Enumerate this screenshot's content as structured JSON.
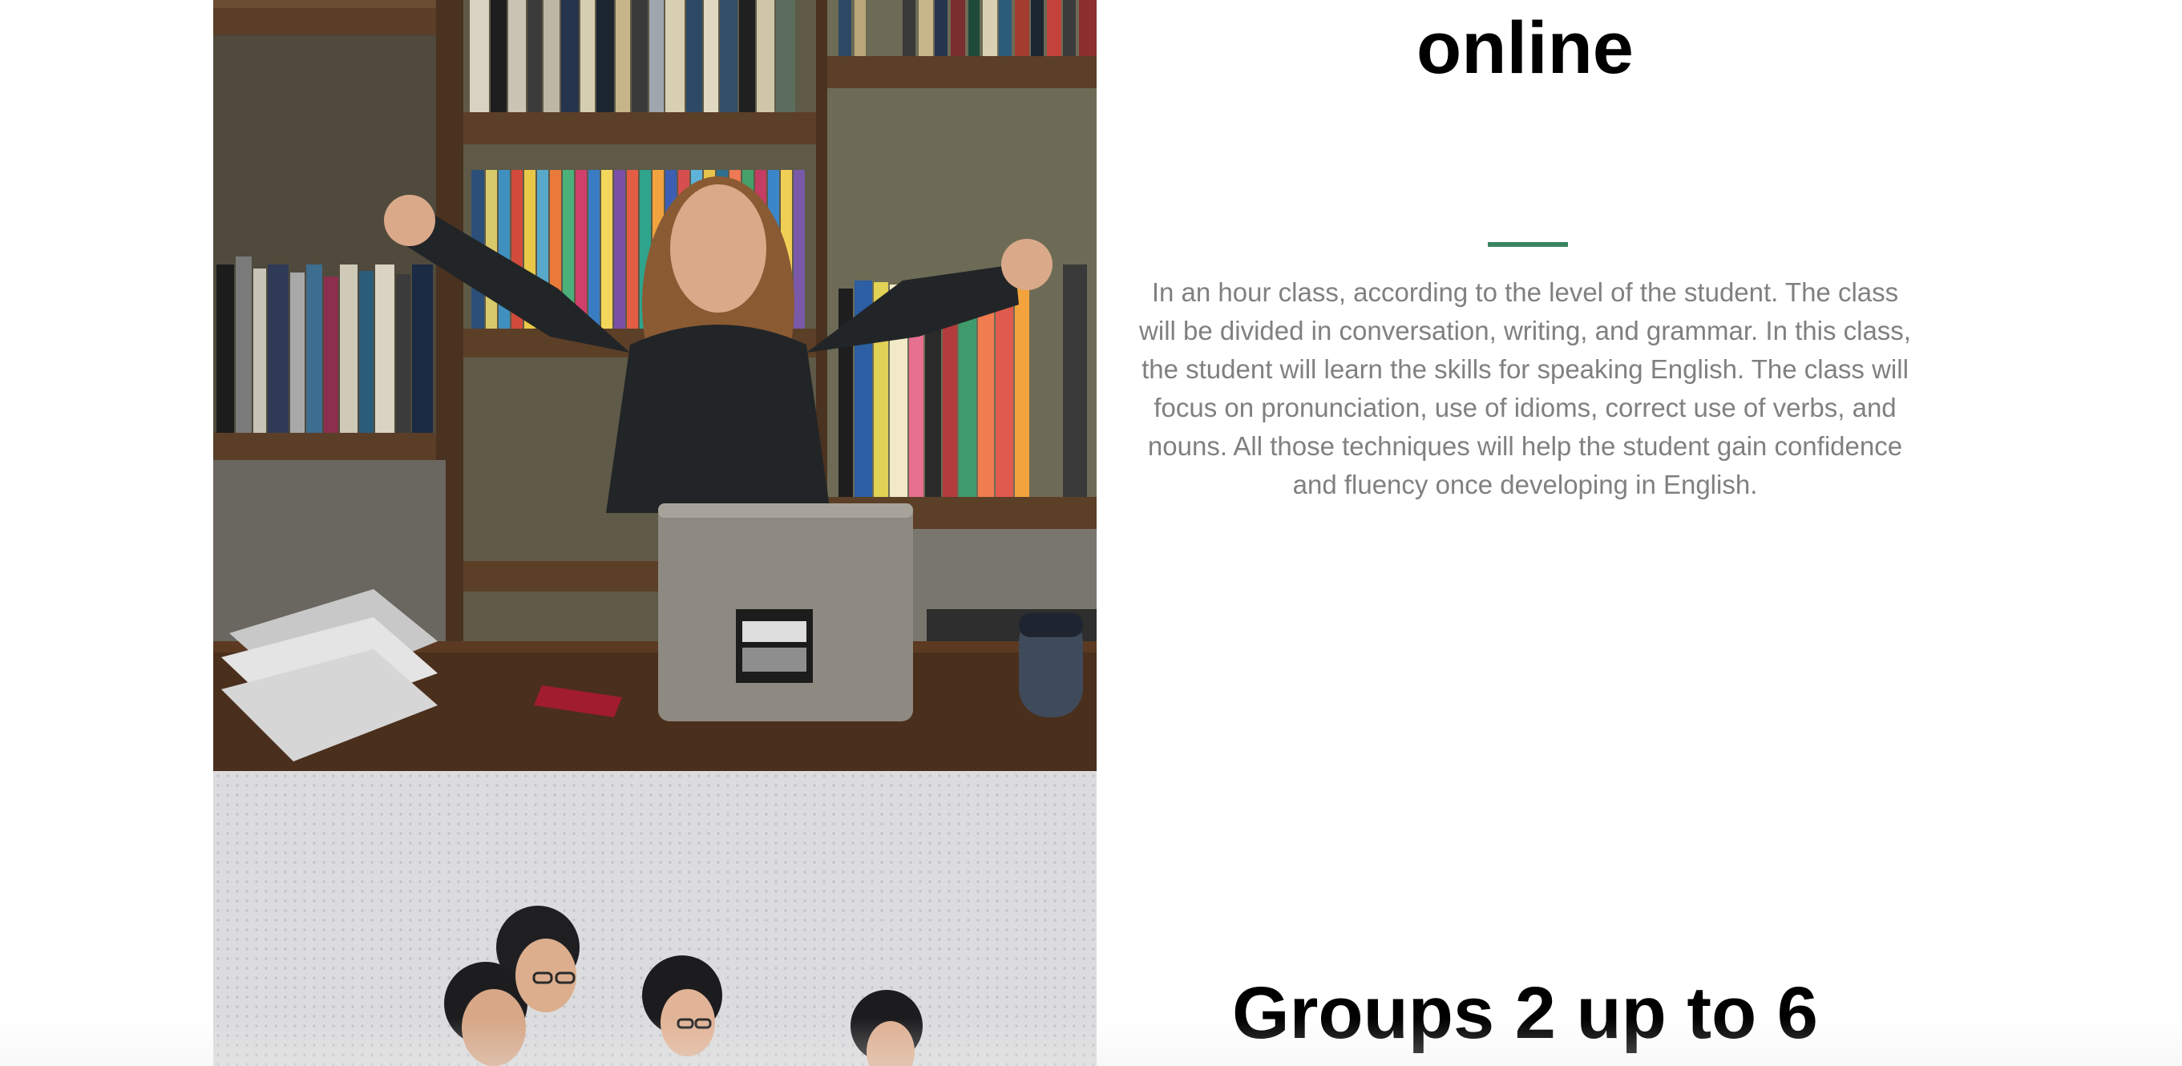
{
  "section_online": {
    "heading": "online",
    "accent_color": "#3a8560",
    "description": "In an hour class, according to the level of the student. The class will be divided in conversation, writing, and grammar. In this class, the student will learn the skills for speaking English. The class will focus on pronunciation, use of idioms, correct use of verbs, and nouns. All those techniques will help the student gain confidence and fluency once developing in English.",
    "image": "girl-celebrating-at-laptop-photo"
  },
  "section_groups": {
    "heading": "Groups 2 up to 6",
    "image": "group-of-students-photo"
  },
  "colors": {
    "heading": "#000000",
    "body_text": "#808080",
    "accent": "#3a8560",
    "background": "#ffffff"
  }
}
